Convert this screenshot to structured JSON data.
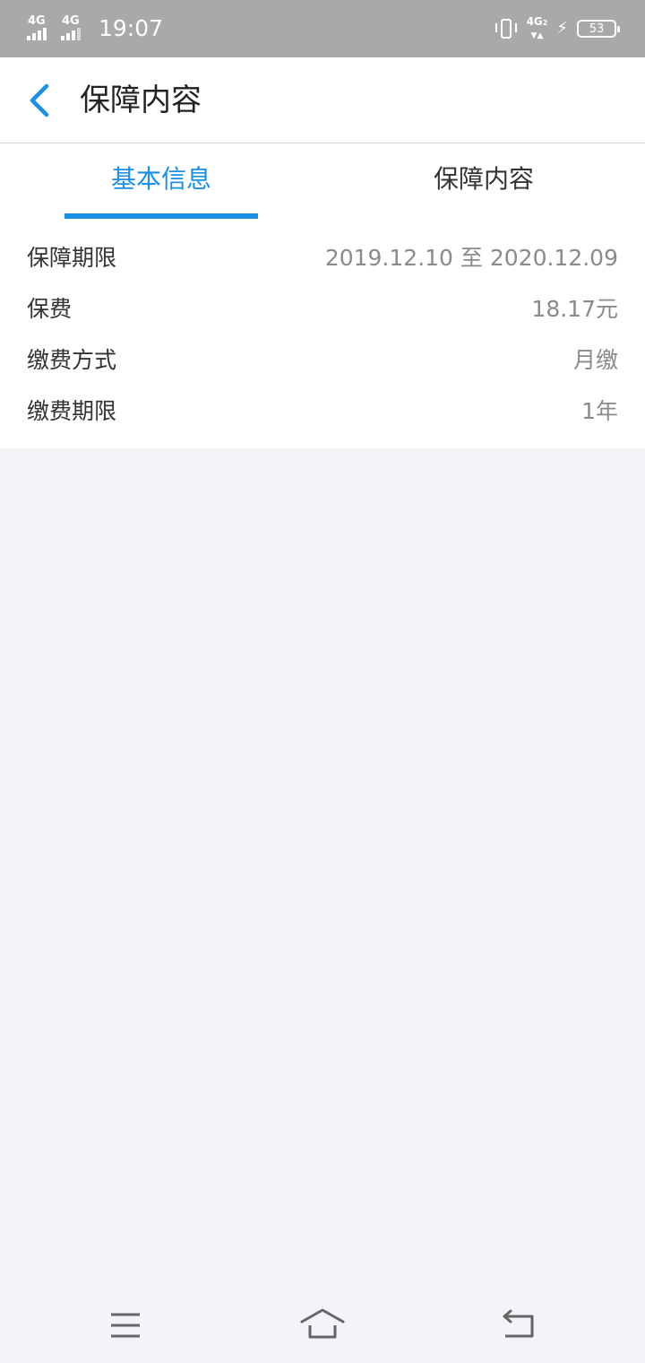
{
  "status_bar": {
    "sim1_network": "4G",
    "sim2_network": "4G",
    "time": "19:07",
    "data_network": "4G",
    "data_sim": "2",
    "battery_level": "53",
    "icons": [
      "signal-icon",
      "vibrate-icon",
      "charging-icon",
      "battery-icon"
    ]
  },
  "header": {
    "title": "保障内容",
    "back_icon": "chevron-left-icon"
  },
  "tabs": [
    {
      "label": "基本信息",
      "active": true
    },
    {
      "label": "保障内容",
      "active": false
    }
  ],
  "info": {
    "rows": [
      {
        "label": "保障期限",
        "value": "2019.12.10 至 2020.12.09"
      },
      {
        "label": "保费",
        "value": "18.17元"
      },
      {
        "label": "缴费方式",
        "value": "月缴"
      },
      {
        "label": "缴费期限",
        "value": "1年"
      }
    ]
  },
  "nav_bar": {
    "icons": [
      "menu-icon",
      "home-icon",
      "back-icon"
    ]
  },
  "colors": {
    "accent": "#1a8fe3",
    "status_bar": "#a9a9a9",
    "page_background": "#f3f3f8"
  }
}
